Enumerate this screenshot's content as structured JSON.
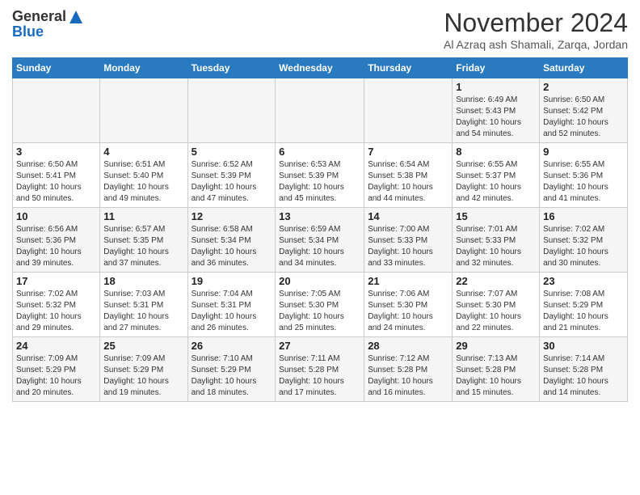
{
  "header": {
    "logo_general": "General",
    "logo_blue": "Blue",
    "month_title": "November 2024",
    "location": "Al Azraq ash Shamali, Zarqa, Jordan"
  },
  "weekdays": [
    "Sunday",
    "Monday",
    "Tuesday",
    "Wednesday",
    "Thursday",
    "Friday",
    "Saturday"
  ],
  "weeks": [
    [
      {
        "day": "",
        "info": ""
      },
      {
        "day": "",
        "info": ""
      },
      {
        "day": "",
        "info": ""
      },
      {
        "day": "",
        "info": ""
      },
      {
        "day": "",
        "info": ""
      },
      {
        "day": "1",
        "info": "Sunrise: 6:49 AM\nSunset: 5:43 PM\nDaylight: 10 hours\nand 54 minutes."
      },
      {
        "day": "2",
        "info": "Sunrise: 6:50 AM\nSunset: 5:42 PM\nDaylight: 10 hours\nand 52 minutes."
      }
    ],
    [
      {
        "day": "3",
        "info": "Sunrise: 6:50 AM\nSunset: 5:41 PM\nDaylight: 10 hours\nand 50 minutes."
      },
      {
        "day": "4",
        "info": "Sunrise: 6:51 AM\nSunset: 5:40 PM\nDaylight: 10 hours\nand 49 minutes."
      },
      {
        "day": "5",
        "info": "Sunrise: 6:52 AM\nSunset: 5:39 PM\nDaylight: 10 hours\nand 47 minutes."
      },
      {
        "day": "6",
        "info": "Sunrise: 6:53 AM\nSunset: 5:39 PM\nDaylight: 10 hours\nand 45 minutes."
      },
      {
        "day": "7",
        "info": "Sunrise: 6:54 AM\nSunset: 5:38 PM\nDaylight: 10 hours\nand 44 minutes."
      },
      {
        "day": "8",
        "info": "Sunrise: 6:55 AM\nSunset: 5:37 PM\nDaylight: 10 hours\nand 42 minutes."
      },
      {
        "day": "9",
        "info": "Sunrise: 6:55 AM\nSunset: 5:36 PM\nDaylight: 10 hours\nand 41 minutes."
      }
    ],
    [
      {
        "day": "10",
        "info": "Sunrise: 6:56 AM\nSunset: 5:36 PM\nDaylight: 10 hours\nand 39 minutes."
      },
      {
        "day": "11",
        "info": "Sunrise: 6:57 AM\nSunset: 5:35 PM\nDaylight: 10 hours\nand 37 minutes."
      },
      {
        "day": "12",
        "info": "Sunrise: 6:58 AM\nSunset: 5:34 PM\nDaylight: 10 hours\nand 36 minutes."
      },
      {
        "day": "13",
        "info": "Sunrise: 6:59 AM\nSunset: 5:34 PM\nDaylight: 10 hours\nand 34 minutes."
      },
      {
        "day": "14",
        "info": "Sunrise: 7:00 AM\nSunset: 5:33 PM\nDaylight: 10 hours\nand 33 minutes."
      },
      {
        "day": "15",
        "info": "Sunrise: 7:01 AM\nSunset: 5:33 PM\nDaylight: 10 hours\nand 32 minutes."
      },
      {
        "day": "16",
        "info": "Sunrise: 7:02 AM\nSunset: 5:32 PM\nDaylight: 10 hours\nand 30 minutes."
      }
    ],
    [
      {
        "day": "17",
        "info": "Sunrise: 7:02 AM\nSunset: 5:32 PM\nDaylight: 10 hours\nand 29 minutes."
      },
      {
        "day": "18",
        "info": "Sunrise: 7:03 AM\nSunset: 5:31 PM\nDaylight: 10 hours\nand 27 minutes."
      },
      {
        "day": "19",
        "info": "Sunrise: 7:04 AM\nSunset: 5:31 PM\nDaylight: 10 hours\nand 26 minutes."
      },
      {
        "day": "20",
        "info": "Sunrise: 7:05 AM\nSunset: 5:30 PM\nDaylight: 10 hours\nand 25 minutes."
      },
      {
        "day": "21",
        "info": "Sunrise: 7:06 AM\nSunset: 5:30 PM\nDaylight: 10 hours\nand 24 minutes."
      },
      {
        "day": "22",
        "info": "Sunrise: 7:07 AM\nSunset: 5:30 PM\nDaylight: 10 hours\nand 22 minutes."
      },
      {
        "day": "23",
        "info": "Sunrise: 7:08 AM\nSunset: 5:29 PM\nDaylight: 10 hours\nand 21 minutes."
      }
    ],
    [
      {
        "day": "24",
        "info": "Sunrise: 7:09 AM\nSunset: 5:29 PM\nDaylight: 10 hours\nand 20 minutes."
      },
      {
        "day": "25",
        "info": "Sunrise: 7:09 AM\nSunset: 5:29 PM\nDaylight: 10 hours\nand 19 minutes."
      },
      {
        "day": "26",
        "info": "Sunrise: 7:10 AM\nSunset: 5:29 PM\nDaylight: 10 hours\nand 18 minutes."
      },
      {
        "day": "27",
        "info": "Sunrise: 7:11 AM\nSunset: 5:28 PM\nDaylight: 10 hours\nand 17 minutes."
      },
      {
        "day": "28",
        "info": "Sunrise: 7:12 AM\nSunset: 5:28 PM\nDaylight: 10 hours\nand 16 minutes."
      },
      {
        "day": "29",
        "info": "Sunrise: 7:13 AM\nSunset: 5:28 PM\nDaylight: 10 hours\nand 15 minutes."
      },
      {
        "day": "30",
        "info": "Sunrise: 7:14 AM\nSunset: 5:28 PM\nDaylight: 10 hours\nand 14 minutes."
      }
    ]
  ]
}
